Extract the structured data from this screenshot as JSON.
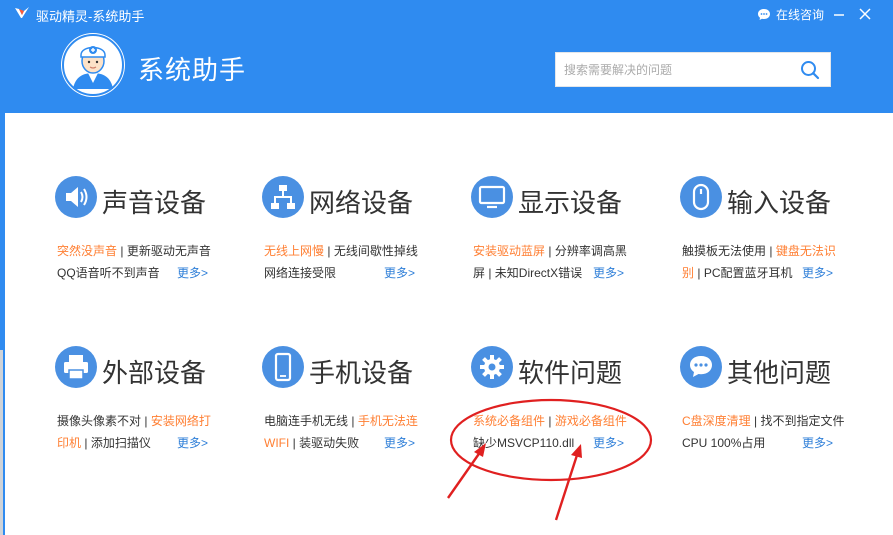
{
  "app": {
    "title": "驱动精灵-系统助手",
    "online_label": "在线咨询"
  },
  "header": {
    "page_title": "系统助手",
    "search_placeholder": "搜索需要解决的问题"
  },
  "colors": {
    "brand": "#2f8bf0",
    "link": "#ff7f33",
    "more": "#2f7fd8",
    "annotation": "#e02020"
  },
  "categories": [
    {
      "title": "声音设备",
      "icon": "speaker-icon",
      "l1": {
        "a": "突然没声音",
        "s": " | ",
        "b": "更新驱动无声音"
      },
      "l2": {
        "b": "QQ语音听不到声音"
      },
      "more": "更多>"
    },
    {
      "title": "网络设备",
      "icon": "network-icon",
      "l1": {
        "a": "无线上网慢",
        "s": " | ",
        "b": "无线间歇性掉线"
      },
      "l2": {
        "b": "网络连接受限"
      },
      "more": "更多>"
    },
    {
      "title": "显示设备",
      "icon": "monitor-icon",
      "l1": {
        "a": "安装驱动蓝屏",
        "s": " | ",
        "b": "分辨率调高黑"
      },
      "l2": {
        "b": "屏 | 未知DirectX错误"
      },
      "more": "更多>"
    },
    {
      "title": "输入设备",
      "icon": "mouse-icon",
      "l1": {
        "b": "触摸板无法使用",
        "s": " | ",
        "a": "键盘无法识"
      },
      "l2": {
        "a": "别",
        "s": " | ",
        "b": "PC配置蓝牙耳机"
      },
      "more": "更多>"
    },
    {
      "title": "外部设备",
      "icon": "printer-icon",
      "l1": {
        "b": "摄像头像素不对",
        "s": " | ",
        "a": "安装网络打"
      },
      "l2": {
        "a": "印机",
        "s": " | ",
        "b": "添加扫描仪"
      },
      "more": "更多>"
    },
    {
      "title": "手机设备",
      "icon": "phone-icon",
      "l1": {
        "b": "电脑连手机无线",
        "s": " | ",
        "a": "手机无法连"
      },
      "l2": {
        "a": "WIFI",
        "s": " | ",
        "b": "装驱动失败"
      },
      "more": "更多>"
    },
    {
      "title": "软件问题",
      "icon": "gear-icon",
      "l1": {
        "a": "系统必备组件",
        "s": " | ",
        "b": "游戏必备组件"
      },
      "l2": {
        "b": "缺少MSVCP110.dll"
      },
      "more": "更多>"
    },
    {
      "title": "其他问题",
      "icon": "chat-bubble-icon",
      "l1": {
        "a": "C盘深度清理",
        "s": " | ",
        "b": "找不到指定文件"
      },
      "l2": {
        "b": "CPU 100%占用"
      },
      "more": "更多>"
    }
  ]
}
